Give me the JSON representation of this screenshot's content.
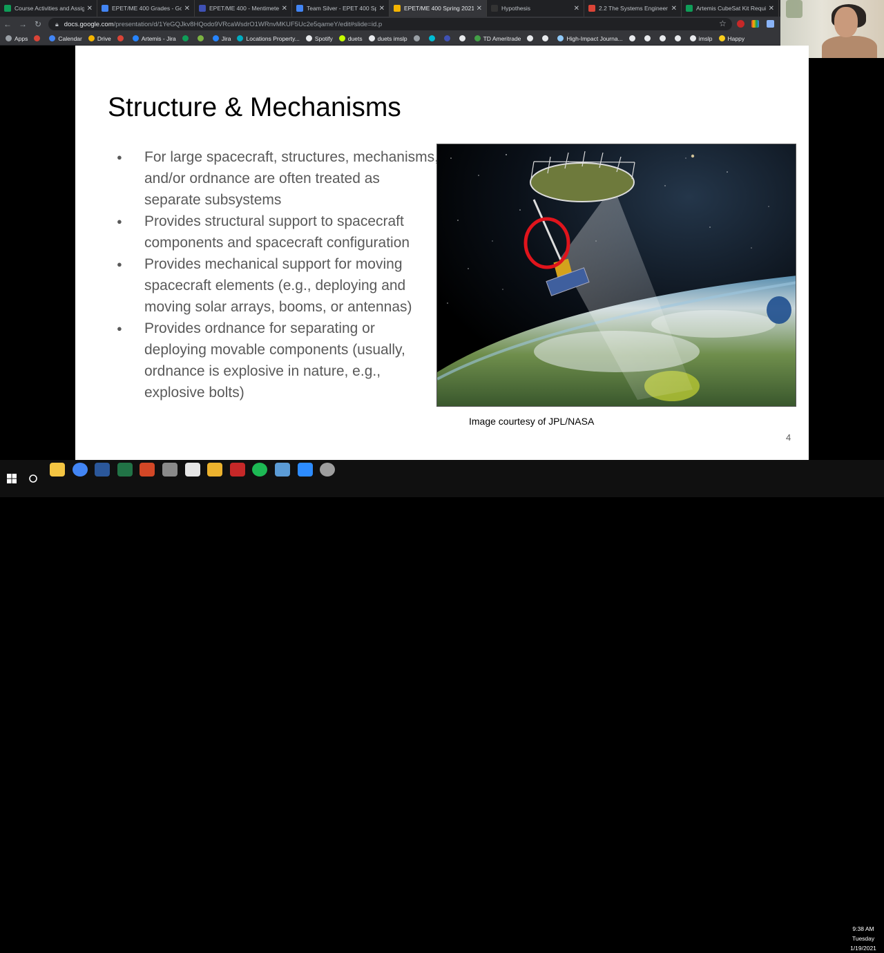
{
  "tabs": [
    {
      "title": "Course Activities and Assig",
      "color": "#0f9d58",
      "active": false
    },
    {
      "title": "EPET/ME 400 Grades - Goo",
      "color": "#4285f4",
      "active": false
    },
    {
      "title": "EPET/ME 400 - Mentimeter",
      "color": "#3f51b5",
      "active": false
    },
    {
      "title": "Team Silver - EPET 400 Spr",
      "color": "#4285f4",
      "active": false
    },
    {
      "title": "EPET/ME 400 Spring 2021",
      "color": "#f4b400",
      "active": true
    },
    {
      "title": "Hypothesis",
      "color": "#333333",
      "active": false
    },
    {
      "title": "2.2 The Systems Engineer -",
      "color": "#db4437",
      "active": false
    },
    {
      "title": "Artemis CubeSat Kit Requir",
      "color": "#0f9d58",
      "active": false
    }
  ],
  "address": {
    "host": "docs.google.com",
    "path": "/presentation/d/1YeGQJkv8HQodo9VRcaWsdrO1WRnvMKUF5Uc2e5qameY/edit#slide=id.p"
  },
  "bookmarks": [
    {
      "label": "Apps",
      "color": "#9aa0a6"
    },
    {
      "label": "",
      "color": "#db4437"
    },
    {
      "label": "Calendar",
      "color": "#4285f4"
    },
    {
      "label": "Drive",
      "color": "#f4b400"
    },
    {
      "label": "",
      "color": "#db4437"
    },
    {
      "label": "Artemis - Jira",
      "color": "#2684ff"
    },
    {
      "label": "",
      "color": "#0f9d58"
    },
    {
      "label": "",
      "color": "#7cb342"
    },
    {
      "label": "Jira",
      "color": "#2684ff"
    },
    {
      "label": "Locations Property...",
      "color": "#00acc1"
    },
    {
      "label": "Spotify",
      "color": "#e8eaed"
    },
    {
      "label": "duets",
      "color": "#c6ff00"
    },
    {
      "label": "duets imslp",
      "color": "#e8eaed"
    },
    {
      "label": "",
      "color": "#9aa0a6"
    },
    {
      "label": "",
      "color": "#00bcd4"
    },
    {
      "label": "",
      "color": "#3f51b5"
    },
    {
      "label": "",
      "color": "#e8eaed"
    },
    {
      "label": "TD Ameritrade",
      "color": "#43a047"
    },
    {
      "label": "",
      "color": "#e8eaed"
    },
    {
      "label": "",
      "color": "#e8eaed"
    },
    {
      "label": "High-Impact Journa...",
      "color": "#90caf9"
    },
    {
      "label": "",
      "color": "#e8eaed"
    },
    {
      "label": "",
      "color": "#e8eaed"
    },
    {
      "label": "",
      "color": "#e8eaed"
    },
    {
      "label": "",
      "color": "#e8eaed"
    },
    {
      "label": "imslp",
      "color": "#e8eaed"
    },
    {
      "label": "Happy",
      "color": "#f9ce1d"
    }
  ],
  "slide": {
    "title": "Structure & Mechanisms",
    "bullets": [
      "For large spacecraft, structures, mechanisms, and/or ordnance are often treated as separate subsystems",
      "Provides structural support to spacecraft components and spacecraft configuration",
      "Provides mechanical support for moving spacecraft elements (e.g., deploying and moving solar arrays, booms, or antennas)",
      "Provides ordnance for separating or deploying movable components (usually, ordnance is explosive in nature, e.g., explosive bolts)"
    ],
    "caption": "Image courtesy of JPL/NASA",
    "page_number": "4"
  },
  "taskbar": {
    "apps": [
      {
        "name": "file-explorer-icon",
        "color": "#f4c542"
      },
      {
        "name": "chrome-icon",
        "color": "#4285f4"
      },
      {
        "name": "word-icon",
        "color": "#2b579a"
      },
      {
        "name": "excel-icon",
        "color": "#217346"
      },
      {
        "name": "powerpoint-icon",
        "color": "#d24726"
      },
      {
        "name": "app-icon",
        "color": "#8a8a8a"
      },
      {
        "name": "acrobat-icon",
        "color": "#e6e6e6"
      },
      {
        "name": "slack-icon",
        "color": "#ecb22e"
      },
      {
        "name": "app-icon",
        "color": "#c62828"
      },
      {
        "name": "spotify-icon",
        "color": "#1db954"
      },
      {
        "name": "app-icon",
        "color": "#5b9bd5"
      },
      {
        "name": "zoom-icon",
        "color": "#2d8cff"
      },
      {
        "name": "chrome-icon",
        "color": "#9e9e9e"
      }
    ],
    "time": "9:38 AM",
    "day": "Tuesday",
    "date": "1/19/2021"
  }
}
